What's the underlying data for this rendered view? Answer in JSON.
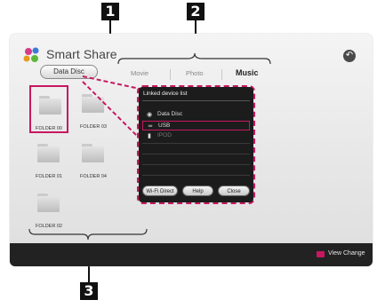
{
  "callouts": {
    "one": "1",
    "two": "2",
    "three": "3"
  },
  "header": {
    "title": "Smart Share",
    "source_button": "Data Disc",
    "back_icon": "back-arrow-icon"
  },
  "tabs": [
    {
      "label": "Movie",
      "active": false
    },
    {
      "label": "Photo",
      "active": false
    },
    {
      "label": "Music",
      "active": true
    }
  ],
  "folders": [
    {
      "label": "FOLDER 00",
      "selected": true
    },
    {
      "label": "FOLDER 03",
      "selected": false
    },
    {
      "label": "FOLDER 01",
      "selected": false
    },
    {
      "label": "FOLDER 04",
      "selected": false
    },
    {
      "label": "FOLDER 02",
      "selected": false
    }
  ],
  "popup": {
    "title": "Linked device list",
    "devices": [
      {
        "label": "Data Disc",
        "icon": "disc-icon"
      },
      {
        "label": "USB",
        "icon": "usb-icon",
        "selected": true
      },
      {
        "label": "IPOD",
        "icon": "ipod-icon",
        "dim": true
      }
    ],
    "buttons": [
      "Wi-Fi Direct",
      "Help",
      "Close"
    ]
  },
  "footer": {
    "view_change_label": "View Change",
    "color": "#c7185f"
  },
  "colors": {
    "accent": "#c7185f",
    "footer_bg": "#222222"
  }
}
